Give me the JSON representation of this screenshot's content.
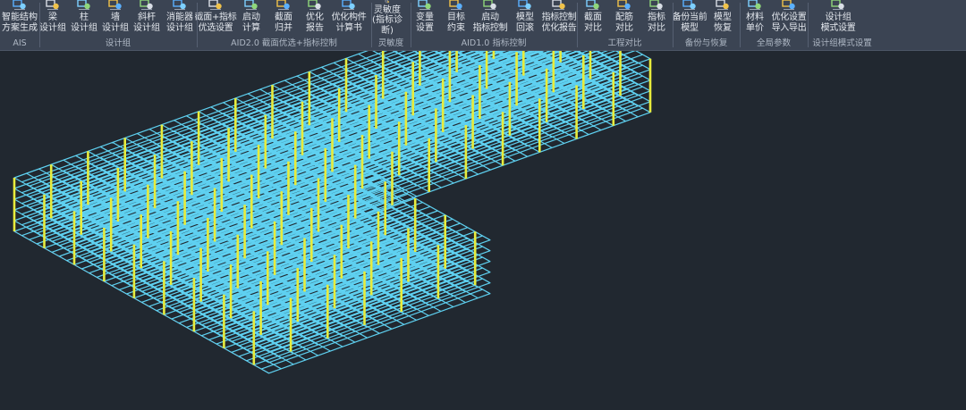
{
  "ribbon": {
    "buttons": [
      {
        "id": "ais",
        "label": "智能结构\n方案生成",
        "icon": "ai-scheme-icon"
      },
      {
        "id": "beam",
        "label": "梁\n设计组",
        "icon": "beam-icon"
      },
      {
        "id": "column",
        "label": "柱\n设计组",
        "icon": "column-icon"
      },
      {
        "id": "wall",
        "label": "墙\n设计组",
        "icon": "wall-icon"
      },
      {
        "id": "brace",
        "label": "斜杆\n设计组",
        "icon": "brace-icon"
      },
      {
        "id": "damper",
        "label": "消能器\n设计组",
        "icon": "damper-icon"
      },
      {
        "id": "section-index",
        "label": "截面+指标\n优选设置",
        "icon": "section-index-icon"
      },
      {
        "id": "start-calc",
        "label": "启动\n计算",
        "icon": "run-icon"
      },
      {
        "id": "section-merge",
        "label": "截面\n归并",
        "icon": "merge-icon"
      },
      {
        "id": "optimize-report",
        "label": "优化\n报告",
        "icon": "report-icon"
      },
      {
        "id": "component-calc",
        "label": "优化构件\n计算书",
        "icon": "calcbook-icon"
      },
      {
        "id": "sensitivity",
        "label": "灵敏度\n(指标诊断)",
        "icon": "sensitivity-icon"
      },
      {
        "id": "variable",
        "label": "变量\n设置",
        "icon": "variable-icon"
      },
      {
        "id": "target",
        "label": "目标\n约束",
        "icon": "target-icon"
      },
      {
        "id": "index-control",
        "label": "启动\n指标控制",
        "icon": "index-run-icon"
      },
      {
        "id": "model-rollback",
        "label": "模型\n回滚",
        "icon": "rollback-icon"
      },
      {
        "id": "index-report",
        "label": "指标控制\n优化报告",
        "icon": "index-report-icon"
      },
      {
        "id": "section-compare",
        "label": "截面\n对比",
        "icon": "section-compare-icon"
      },
      {
        "id": "rebar-compare",
        "label": "配筋\n对比",
        "icon": "rebar-compare-icon"
      },
      {
        "id": "index-compare",
        "label": "指标\n对比",
        "icon": "index-compare-icon"
      },
      {
        "id": "backup-model",
        "label": "备份当前\n模型",
        "icon": "backup-icon"
      },
      {
        "id": "restore-model",
        "label": "模型\n恢复",
        "icon": "restore-icon"
      },
      {
        "id": "material-price",
        "label": "材料\n单价",
        "icon": "material-icon"
      },
      {
        "id": "import-export",
        "label": "优化设置\n导入导出",
        "icon": "import-export-icon"
      },
      {
        "id": "group-mode",
        "label": "设计组\n模式设置",
        "icon": "group-mode-icon"
      }
    ],
    "groups": [
      {
        "id": "ais",
        "label": "AIS"
      },
      {
        "id": "design-group",
        "label": "设计组"
      },
      {
        "id": "aid2",
        "label": "AID2.0 截面优选+指标控制"
      },
      {
        "id": "sensitivity",
        "label": "灵敏度"
      },
      {
        "id": "aid1",
        "label": "AID1.0 指标控制"
      },
      {
        "id": "compare",
        "label": "工程对比"
      },
      {
        "id": "backup",
        "label": "备份与恢复"
      },
      {
        "id": "global",
        "label": "全局参数"
      },
      {
        "id": "mode",
        "label": "设计组模式设置"
      }
    ]
  },
  "viewport": {
    "background": "#212830",
    "beam_color": "#5ed0f0",
    "column_color": "#e8ec3c",
    "axis_color": "#e03c30"
  }
}
